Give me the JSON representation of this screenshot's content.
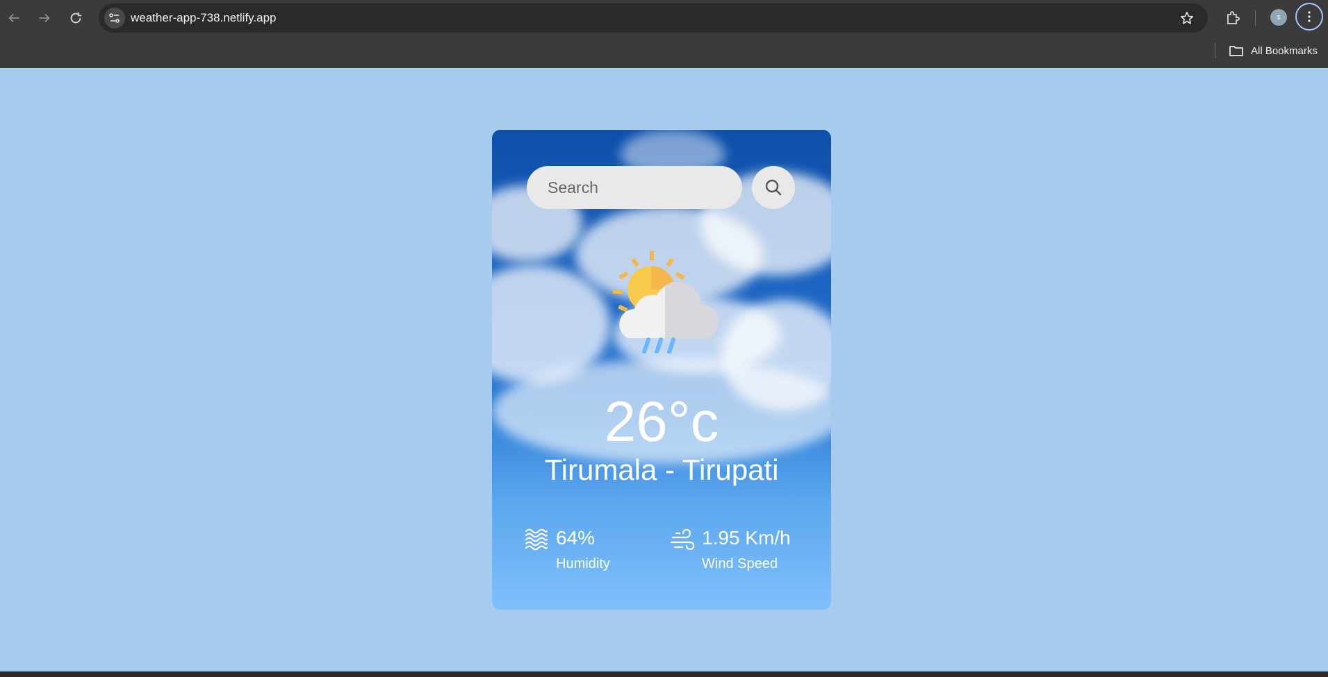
{
  "browser": {
    "url": "weather-app-738.netlify.app",
    "profile_initial": "s",
    "bookmarks_label": "All Bookmarks",
    "icons": {
      "back": "arrow-left-icon",
      "forward": "arrow-right-icon",
      "reload": "reload-icon",
      "site_info": "site-info-icon",
      "bookmark": "star-icon",
      "extensions": "puzzle-icon",
      "menu": "more-vertical-icon",
      "folder": "folder-icon"
    }
  },
  "weather": {
    "search_placeholder": "Search",
    "temperature": "26°c",
    "city": "Tirumala - Tirupati",
    "humidity": {
      "value": "64%",
      "label": "Humidity"
    },
    "wind": {
      "value": "1.95 Km/h",
      "label": "Wind Speed"
    },
    "condition_icon": "sun-cloud-rain-icon"
  },
  "colors": {
    "page_background": "#a7cbed",
    "browser_background": "#3b3b3b",
    "card_top": "#0d4faa",
    "card_bottom": "#7fc0fb",
    "search_background": "#e9e9e9",
    "text": "#ffffff"
  }
}
